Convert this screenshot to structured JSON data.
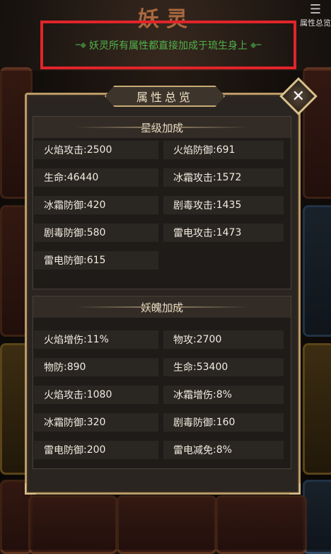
{
  "background": {
    "title": "妖灵",
    "corner_label": "属性总览"
  },
  "notice": "妖灵所有属性都直接加成于琉生身上",
  "panel": {
    "title": "属性总览",
    "sections": [
      {
        "title": "星级加成",
        "stats": [
          {
            "name": "火焰攻击",
            "value": "2500"
          },
          {
            "name": "火焰防御",
            "value": "691"
          },
          {
            "name": "生命",
            "value": "46440"
          },
          {
            "name": "冰霜攻击",
            "value": "1572"
          },
          {
            "name": "冰霜防御",
            "value": "420"
          },
          {
            "name": "剧毒攻击",
            "value": "1435"
          },
          {
            "name": "剧毒防御",
            "value": "580"
          },
          {
            "name": "雷电攻击",
            "value": "1473"
          },
          {
            "name": "雷电防御",
            "value": "615"
          }
        ]
      },
      {
        "title": "妖魄加成",
        "stats": [
          {
            "name": "火焰增伤",
            "value": "11%"
          },
          {
            "name": "物攻",
            "value": "2700"
          },
          {
            "name": "物防",
            "value": "890"
          },
          {
            "name": "生命",
            "value": "53400"
          },
          {
            "name": "火焰攻击",
            "value": "1080"
          },
          {
            "name": "冰霜增伤",
            "value": "8%"
          },
          {
            "name": "冰霜防御",
            "value": "320"
          },
          {
            "name": "剧毒防御",
            "value": "160"
          },
          {
            "name": "雷电防御",
            "value": "200"
          },
          {
            "name": "雷电减免",
            "value": "8%"
          }
        ]
      }
    ]
  },
  "colors": {
    "notice_text": "#4fb24a",
    "highlight_border": "#e0242a",
    "panel_border": "#b99a68"
  },
  "icons": {
    "close": "close-icon",
    "corner": "stats-icon"
  }
}
